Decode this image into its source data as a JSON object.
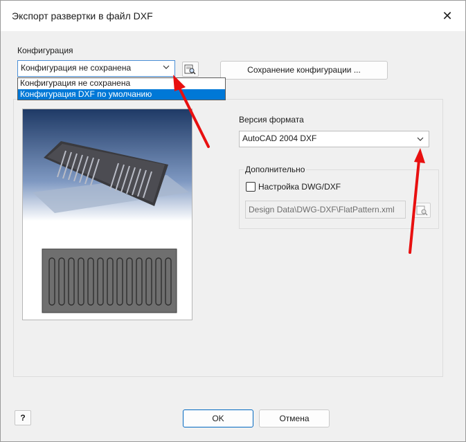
{
  "window": {
    "title": "Экспорт развертки в файл DXF",
    "close_glyph": "✕"
  },
  "configuration": {
    "label": "Конфигурация",
    "selected": "Конфигурация не сохранена",
    "options": [
      "Конфигурация не сохранена",
      "Конфигурация DXF по умолчанию"
    ],
    "highlighted_option": "Конфигурация DXF по умолчанию",
    "save_button_label": "Сохранение конфигурации ..."
  },
  "format": {
    "label": "Версия формата",
    "selected": "AutoCAD 2004 DXF"
  },
  "additional": {
    "group_label": "Дополнительно",
    "checkbox_label": "Настройка DWG/DXF",
    "checkbox_checked": false,
    "path_value": "Design Data\\DWG-DXF\\FlatPattern.xml"
  },
  "footer": {
    "ok_label": "OK",
    "cancel_label": "Отмена",
    "help_glyph": "?"
  },
  "annotations": {
    "arrow_color": "#e81010"
  },
  "colors": {
    "selection": "#0078d7",
    "dialog_bg": "#f0f0f0"
  }
}
